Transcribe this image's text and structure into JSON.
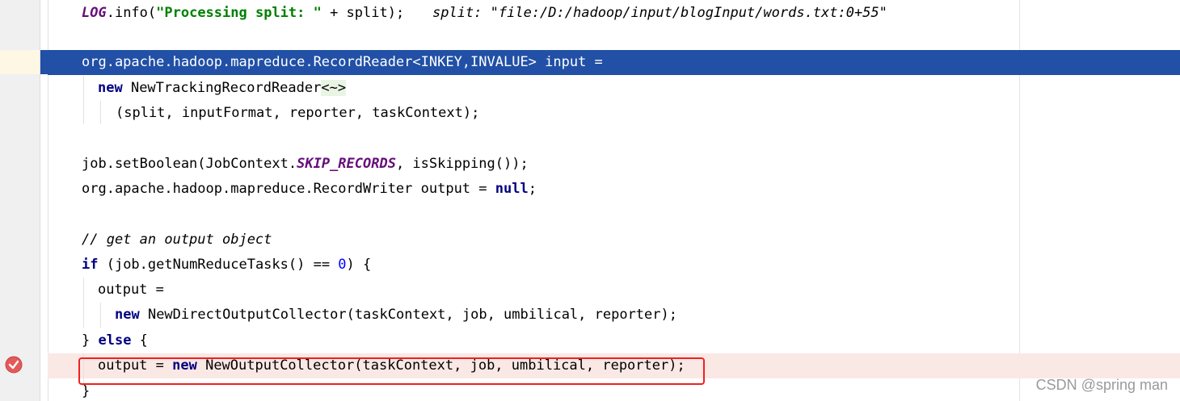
{
  "editor": {
    "lines": {
      "l1_a": "LOG",
      "l1_b": ".info(",
      "l1_c": "\"Processing split: \"",
      "l1_d": " + split);",
      "l1_hint": "split: \"file:/D:/hadoop/input/blogInput/words.txt:0+55\"",
      "l3": "org.apache.hadoop.mapreduce.RecordReader<INKEY,INVALUE> input =",
      "l4_kw": "new",
      "l4_b": " NewTrackingRecordReader",
      "l4_diamond": "<~>",
      "l5": "(split, inputFormat, reporter, taskContext);",
      "l7_a": "job.setBoolean(JobContext.",
      "l7_b": "SKIP_RECORDS",
      "l7_c": ", isSkipping());",
      "l8_a": "org.apache.hadoop.mapreduce.RecordWriter output = ",
      "l8_kw": "null",
      "l8_c": ";",
      "l10": "// get an output object",
      "l11_kw": "if",
      "l11_b": " (job.getNumReduceTasks() == ",
      "l11_num": "0",
      "l11_c": ") {",
      "l12": "output =",
      "l13_kw": "new",
      "l13_b": " NewDirectOutputCollector(taskContext, job, umbilical, reporter);",
      "l14_a": "} ",
      "l14_kw": "else",
      "l14_c": " {",
      "l15_a": "output = ",
      "l15_kw": "new",
      "l15_c": " NewOutputCollector(taskContext, job, umbilical, reporter);",
      "l16": "}"
    },
    "icons": {
      "breakpoint": "breakpoint-check-icon"
    },
    "colors": {
      "selection": "#2150a6",
      "breakpoint_line": "#fae8e5",
      "keyword": "#000080",
      "string": "#008000",
      "highlight_box": "#f02020"
    }
  },
  "watermark": "CSDN @spring man"
}
